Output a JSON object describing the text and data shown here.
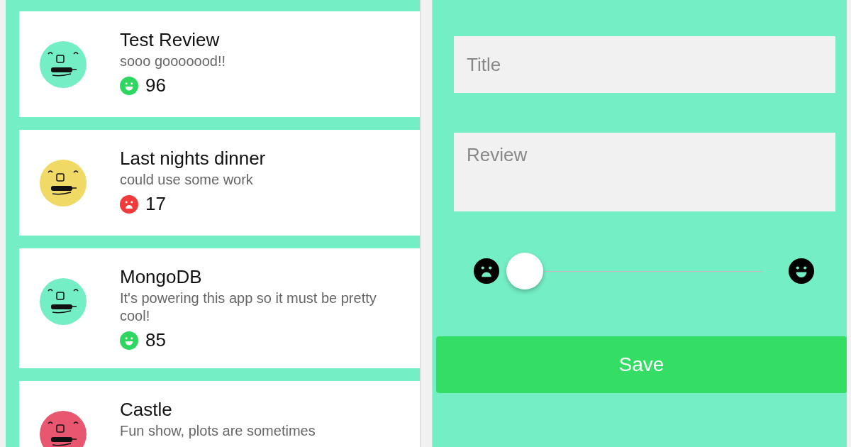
{
  "reviews": [
    {
      "title": "Test Review",
      "text": "sooo gooooood!!",
      "kind": "happy",
      "score": "96",
      "color": "#74efc5"
    },
    {
      "title": "Last nights dinner",
      "text": "could use some work",
      "kind": "sad",
      "score": "17",
      "color": "#f0d965"
    },
    {
      "title": "MongoDB",
      "text": "It's powering this app so it must be pretty cool!",
      "kind": "happy",
      "score": "85",
      "color": "#74efc5"
    },
    {
      "title": "Castle",
      "text": "Fun show, plots are sometimes",
      "color": "#e9566f"
    }
  ],
  "form": {
    "title_placeholder": "Title",
    "review_placeholder": "Review",
    "rating": {
      "level": 0.0
    },
    "save": "Save"
  }
}
